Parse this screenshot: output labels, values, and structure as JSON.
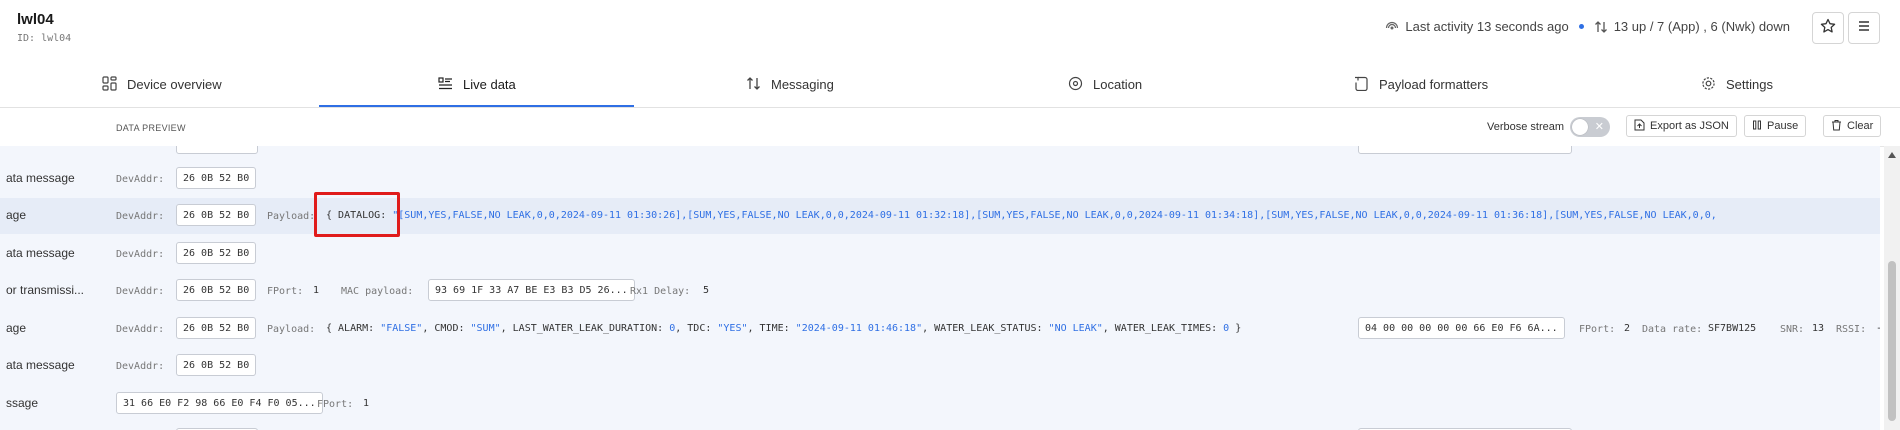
{
  "device": {
    "name": "lwl04",
    "id_label": "ID: lwl04"
  },
  "status": {
    "activity": "Last activity 13 seconds ago",
    "counts": "13 up / 7 (App) , 6 (Nwk) down"
  },
  "tabs": [
    {
      "label": "Device overview",
      "icon": "grid-icon"
    },
    {
      "label": "Live data",
      "icon": "list-icon"
    },
    {
      "label": "Messaging",
      "icon": "arrows-updown-icon"
    },
    {
      "label": "Location",
      "icon": "pin-icon"
    },
    {
      "label": "Payload formatters",
      "icon": "code-icon"
    },
    {
      "label": "Settings",
      "icon": "gear-icon"
    }
  ],
  "toolbar": {
    "preview_label": "DATA PREVIEW",
    "verbose_label": "Verbose stream",
    "export_label": "Export as JSON",
    "pause_label": "Pause",
    "clear_label": "Clear"
  },
  "labels": {
    "devaddr": "DevAddr:",
    "payload": "Payload:",
    "fport": "FPort:",
    "mac_payload": "MAC payload:",
    "rx1": "Rx1 Delay:",
    "data_rate": "Data rate:",
    "snr": "SNR:",
    "rssi": "RSSI:"
  },
  "rows": [
    {
      "type": "ata message",
      "devaddr": "26 0B 52 B0"
    },
    {
      "type": "age",
      "devaddr": "26 0B 52 B0",
      "payload_key": "DATALOG:",
      "payload_value": "\"[SUM,YES,FALSE,NO LEAK,0,0,2024-09-11 01:30:26],[SUM,YES,FALSE,NO LEAK,0,0,2024-09-11 01:32:18],[SUM,YES,FALSE,NO LEAK,0,0,2024-09-11 01:34:18],[SUM,YES,FALSE,NO LEAK,0,0,2024-09-11 01:36:18],[SUM,YES,FALSE,NO LEAK,0,0,"
    },
    {
      "type": "ata message",
      "devaddr": "26 0B 52 B0"
    },
    {
      "type": "or transmissi...",
      "devaddr": "26 0B 52 B0",
      "fport": "1",
      "mac_payload": "93 69 1F 33 A7 BE E3 B3 D5 26...",
      "rx1": "5"
    },
    {
      "type": "age",
      "devaddr": "26 0B 52 B0",
      "alarm": "\"FALSE\"",
      "cmod": "\"SUM\"",
      "lwld": "0",
      "tdc": "\"YES\"",
      "time": "\"2024-09-11 01:46:18\"",
      "wls": "\"NO LEAK\"",
      "wlt": "0",
      "raw": "04 00 00 00 00 00 66 E0 F6 6A...",
      "fport": "2",
      "data_rate": "SF7BW125",
      "snr": "13",
      "rssi": "-"
    },
    {
      "type": "ata message",
      "devaddr": "26 0B 52 B0"
    },
    {
      "type": "ssage",
      "raw": "31 66 E0 F2 98 66 E0 F4 F0 05...",
      "fport": "1"
    }
  ],
  "colors": {
    "accent": "#2f6fe4",
    "highlight_box": "#e01b1b"
  }
}
